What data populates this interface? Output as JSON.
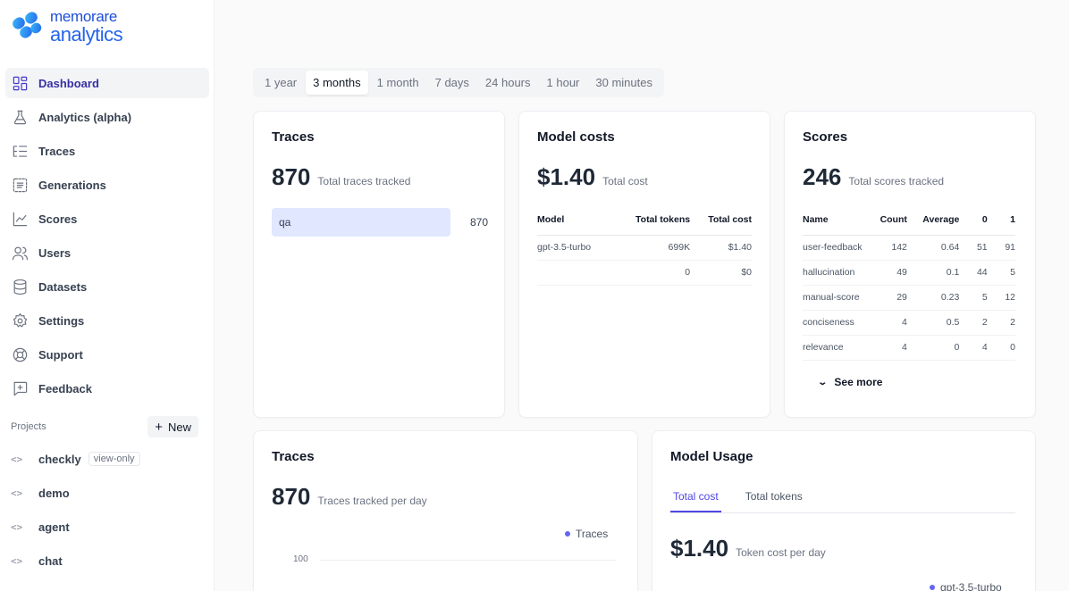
{
  "brand": {
    "top": "memorare",
    "bottom": "analytics"
  },
  "nav": [
    {
      "label": "Dashboard",
      "icon": "dashboard-icon",
      "active": true
    },
    {
      "label": "Analytics (alpha)",
      "icon": "flask-icon"
    },
    {
      "label": "Traces",
      "icon": "list-tree-icon"
    },
    {
      "label": "Generations",
      "icon": "text-box-icon"
    },
    {
      "label": "Scores",
      "icon": "line-chart-icon"
    },
    {
      "label": "Users",
      "icon": "users-icon"
    },
    {
      "label": "Datasets",
      "icon": "database-icon"
    },
    {
      "label": "Settings",
      "icon": "gear-icon"
    },
    {
      "label": "Support",
      "icon": "lifebuoy-icon"
    },
    {
      "label": "Feedback",
      "icon": "message-plus-icon"
    }
  ],
  "projects": {
    "label": "Projects",
    "new_label": "New",
    "items": [
      {
        "name": "checkly",
        "badge": "view-only"
      },
      {
        "name": "demo"
      },
      {
        "name": "agent"
      },
      {
        "name": "chat"
      }
    ]
  },
  "time_ranges": [
    "1 year",
    "3 months",
    "1 month",
    "7 days",
    "24 hours",
    "1 hour",
    "30 minutes"
  ],
  "selected_time_range": "3 months",
  "traces_card": {
    "title": "Traces",
    "total": "870",
    "total_label": "Total traces tracked",
    "bars": [
      {
        "name": "qa",
        "value": "870",
        "fraction": 1.0
      }
    ]
  },
  "model_costs_card": {
    "title": "Model costs",
    "total": "$1.40",
    "total_label": "Total cost",
    "columns": [
      "Model",
      "Total tokens",
      "Total cost"
    ],
    "rows": [
      [
        "gpt-3.5-turbo",
        "699K",
        "$1.40"
      ],
      [
        "",
        "0",
        "$0"
      ]
    ]
  },
  "scores_card": {
    "title": "Scores",
    "total": "246",
    "total_label": "Total scores tracked",
    "columns": [
      "Name",
      "Count",
      "Average",
      "0",
      "1"
    ],
    "rows": [
      [
        "user-feedback",
        "142",
        "0.64",
        "51",
        "91"
      ],
      [
        "hallucination",
        "49",
        "0.1",
        "44",
        "5"
      ],
      [
        "manual-score",
        "29",
        "0.23",
        "5",
        "12"
      ],
      [
        "conciseness",
        "4",
        "0.5",
        "2",
        "2"
      ],
      [
        "relevance",
        "4",
        "0",
        "4",
        "0"
      ]
    ],
    "see_more": "See more"
  },
  "traces_chart_card": {
    "title": "Traces",
    "total": "870",
    "total_label": "Traces tracked per day",
    "legend": "Traces",
    "y_tick": "100"
  },
  "model_usage_card": {
    "title": "Model Usage",
    "tabs": [
      "Total cost",
      "Total tokens"
    ],
    "active_tab": "Total cost",
    "total": "$1.40",
    "total_label": "Token cost per day",
    "legend": "gpt-3.5-turbo"
  },
  "colors": {
    "accent": "#4f46e5",
    "brand": "#2563eb",
    "bar": "#e0e7ff"
  }
}
